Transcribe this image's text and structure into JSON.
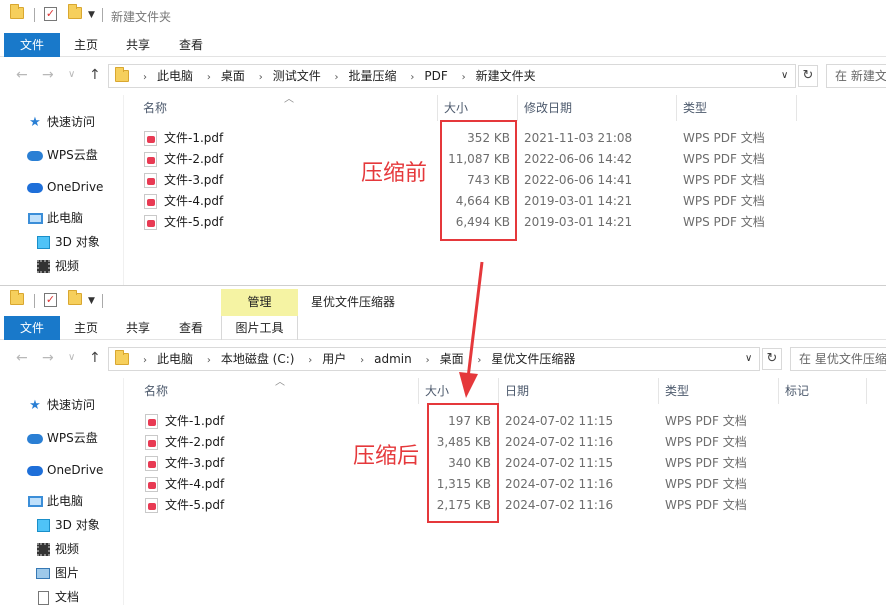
{
  "colors": {
    "accent": "#1979ca",
    "annotation_red": "#e5383b",
    "context_tab": "#f5f3a3"
  },
  "window_top": {
    "title": "新建文件夹",
    "tabs": [
      "文件",
      "主页",
      "共享",
      "查看"
    ],
    "breadcrumb": [
      "此电脑",
      "桌面",
      "测试文件",
      "批量压缩",
      "PDF",
      "新建文件夹"
    ],
    "search_placeholder": "在 新建文",
    "sidebar": [
      {
        "icon": "star-icon",
        "label": "快速访问"
      },
      {
        "icon": "cloud-icon",
        "label": "WPS云盘"
      },
      {
        "icon": "onedrive-icon",
        "label": "OneDrive"
      },
      {
        "icon": "computer-icon",
        "label": "此电脑"
      },
      {
        "icon": "cube-icon",
        "label": "3D 对象"
      },
      {
        "icon": "video-icon",
        "label": "视频"
      }
    ],
    "columns": [
      "名称",
      "大小",
      "修改日期",
      "类型"
    ],
    "files": [
      {
        "name": "文件-1.pdf",
        "size": "352 KB",
        "date": "2021-11-03 21:08",
        "type": "WPS PDF 文档"
      },
      {
        "name": "文件-2.pdf",
        "size": "11,087 KB",
        "date": "2022-06-06 14:42",
        "type": "WPS PDF 文档"
      },
      {
        "name": "文件-3.pdf",
        "size": "743 KB",
        "date": "2022-06-06 14:41",
        "type": "WPS PDF 文档"
      },
      {
        "name": "文件-4.pdf",
        "size": "4,664 KB",
        "date": "2019-03-01 14:21",
        "type": "WPS PDF 文档"
      },
      {
        "name": "文件-5.pdf",
        "size": "6,494 KB",
        "date": "2019-03-01 14:21",
        "type": "WPS PDF 文档"
      }
    ],
    "annotation": "压缩前"
  },
  "window_bottom": {
    "title": "星优文件压缩器",
    "context_tab_header": "管理",
    "context_tab": "图片工具",
    "tabs": [
      "文件",
      "主页",
      "共享",
      "查看"
    ],
    "breadcrumb": [
      "此电脑",
      "本地磁盘 (C:)",
      "用户",
      "admin",
      "桌面",
      "星优文件压缩器"
    ],
    "search_placeholder": "在 星优文件压缩",
    "sidebar": [
      {
        "icon": "star-icon",
        "label": "快速访问"
      },
      {
        "icon": "cloud-icon",
        "label": "WPS云盘"
      },
      {
        "icon": "onedrive-icon",
        "label": "OneDrive"
      },
      {
        "icon": "computer-icon",
        "label": "此电脑"
      },
      {
        "icon": "cube-icon",
        "label": "3D 对象"
      },
      {
        "icon": "video-icon",
        "label": "视频"
      },
      {
        "icon": "picture-icon",
        "label": "图片"
      },
      {
        "icon": "document-icon",
        "label": "文档"
      }
    ],
    "columns": [
      "名称",
      "大小",
      "日期",
      "类型",
      "标记"
    ],
    "files": [
      {
        "name": "文件-1.pdf",
        "size": "197 KB",
        "date": "2024-07-02 11:15",
        "type": "WPS PDF 文档"
      },
      {
        "name": "文件-2.pdf",
        "size": "3,485 KB",
        "date": "2024-07-02 11:16",
        "type": "WPS PDF 文档"
      },
      {
        "name": "文件-3.pdf",
        "size": "340 KB",
        "date": "2024-07-02 11:15",
        "type": "WPS PDF 文档"
      },
      {
        "name": "文件-4.pdf",
        "size": "1,315 KB",
        "date": "2024-07-02 11:16",
        "type": "WPS PDF 文档"
      },
      {
        "name": "文件-5.pdf",
        "size": "2,175 KB",
        "date": "2024-07-02 11:16",
        "type": "WPS PDF 文档"
      }
    ],
    "annotation": "压缩后"
  }
}
